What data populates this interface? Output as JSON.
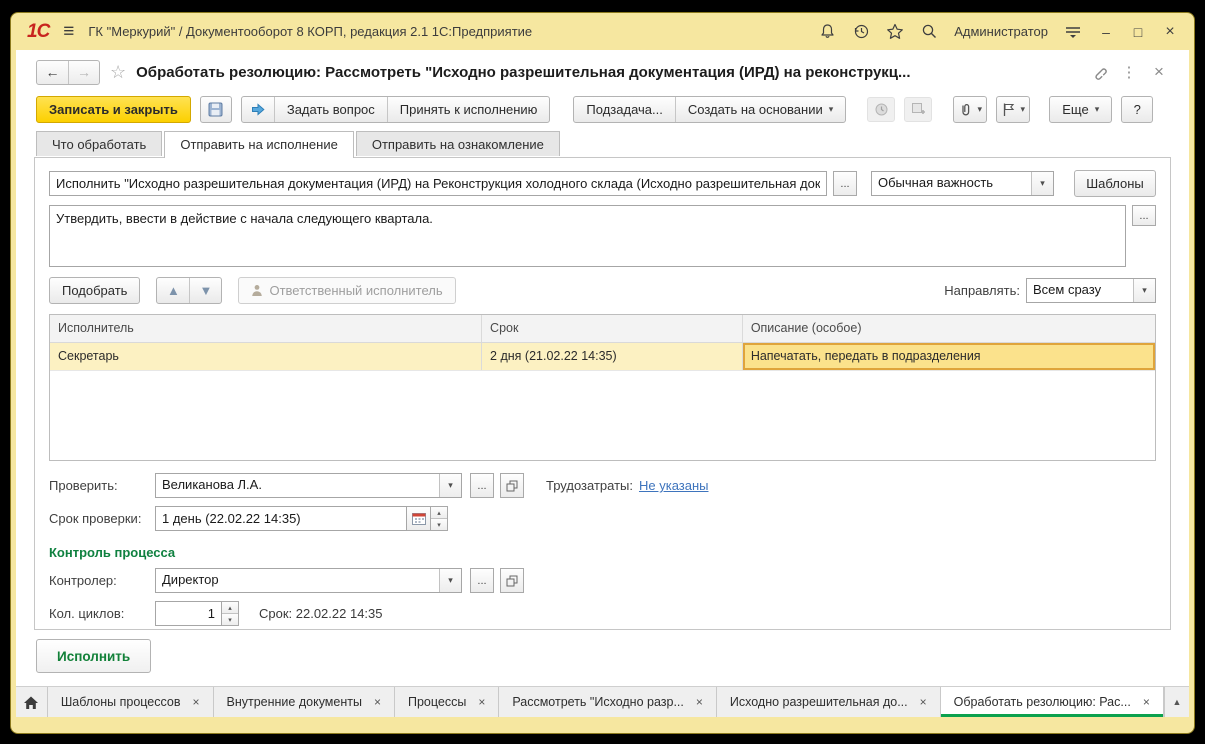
{
  "window": {
    "logo": "1С",
    "title": "ГК \"Меркурий\" / Документооборот 8 КОРП, редакция 2.1 1С:Предприятие",
    "user": "Администратор"
  },
  "form": {
    "title": "Обработать резолюцию: Рассмотреть \"Исходно разрешительная документация (ИРД) на реконструкц...",
    "toolbar": {
      "save_close": "Записать и закрыть",
      "ask_question": "Задать вопрос",
      "accept": "Принять к исполнению",
      "subtask": "Подзадача...",
      "create_based": "Создать на основании",
      "more": "Еще",
      "help": "?"
    },
    "tabs": [
      "Что обработать",
      "Отправить на исполнение",
      "Отправить на ознакомление"
    ],
    "execute_field": "Исполнить \"Исходно разрешительная документация (ИРД) на Реконструкция холодного склада (Исходно разрешительная докуме",
    "importance": "Обычная важность",
    "templates_btn": "Шаблоны",
    "comment": "Утвердить, ввести в действие с начала следующего квартала.",
    "pick_btn": "Подобрать",
    "responsible_btn": "Ответственный исполнитель",
    "route_label": "Направлять:",
    "route_value": "Всем сразу",
    "table": {
      "headers": [
        "Исполнитель",
        "Срок",
        "Описание (особое)"
      ],
      "rows": [
        [
          "Секретарь",
          "2 дня (21.02.22 14:35)",
          "Напечатать, передать в подразделения"
        ]
      ]
    },
    "check": {
      "label": "Проверить:",
      "value": "Великанова Л.А."
    },
    "labor": {
      "label": "Трудозатраты:",
      "value": "Не указаны"
    },
    "check_term": {
      "label": "Срок проверки:",
      "value": "1 день (22.02.22 14:35)"
    },
    "control_section": "Контроль процесса",
    "controller": {
      "label": "Контролер:",
      "value": "Директор"
    },
    "cycles": {
      "label": "Кол. циклов:",
      "value": "1",
      "term": "Срок: 22.02.22 14:35"
    },
    "execute_btn": "Исполнить"
  },
  "bottom_tabs": [
    {
      "label": "Шаблоны процессов"
    },
    {
      "label": "Внутренние документы"
    },
    {
      "label": "Процессы"
    },
    {
      "label": "Рассмотреть \"Исходно разр..."
    },
    {
      "label": "Исходно разрешительная до..."
    },
    {
      "label": "Обработать резолюцию: Рас..."
    }
  ],
  "icons": {
    "menu": "≡",
    "back": "←",
    "forward": "→",
    "favorite": "☆",
    "dots": "⋮",
    "close": "×",
    "minimize": "–",
    "maximize": "□",
    "caret": "▾",
    "up": "▲",
    "down": "▼",
    "ellipsis": "...",
    "spin_up": "▴",
    "spin_down": "▾",
    "panel_up": "▲"
  },
  "colors": {
    "titlebar": "#f6e7a0",
    "accent_yellow": "#fcd000",
    "row_highlight": "#fcf1c2",
    "cell_selected": "#fbe28c",
    "cell_selected_border": "#dfa43b",
    "green": "#0f8140",
    "tab_underline_green": "#0ca14e",
    "link_blue": "#3e74bd",
    "logo_red": "#c8241e"
  }
}
